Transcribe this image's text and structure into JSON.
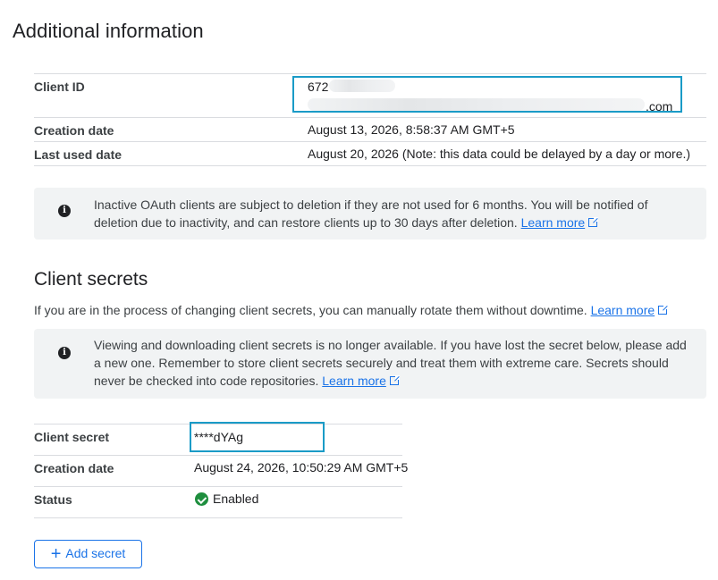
{
  "additional_info": {
    "title": "Additional information",
    "client_id_label": "Client ID",
    "client_id_prefix": "672",
    "client_id_suffix": ".com",
    "creation_date_label": "Creation date",
    "creation_date": "August 13, 2026, 8:58:37 AM GMT+5",
    "last_used_label": "Last used date",
    "last_used": "August 20, 2026 (Note: this data could be delayed by a day or more.)",
    "banner_text": "Inactive OAuth clients are subject to deletion if they are not used for 6 months. You will be notified of deletion due to inactivity, and can restore clients up to 30 days after deletion.",
    "banner_link": "Learn more"
  },
  "client_secrets": {
    "title": "Client secrets",
    "description": "If you are in the process of changing client secrets, you can manually rotate them without downtime.",
    "description_link": "Learn more",
    "banner_text": "Viewing and downloading client secrets is no longer available. If you have lost the secret below, please add a new one. Remember to store client secrets securely and treat them with extreme care. Secrets should never be checked into code repositories.",
    "banner_link": "Learn more",
    "secret_label": "Client secret",
    "secret_value": "****dYAg",
    "creation_date_label": "Creation date",
    "creation_date": "August 24, 2026, 10:50:29 AM GMT+5",
    "status_label": "Status",
    "status_value": "Enabled",
    "add_button_label": "Add secret"
  },
  "icons": [
    "info-icon",
    "external-link-icon",
    "check-circle-icon",
    "plus-icon"
  ],
  "colors": {
    "link": "#1a73e8",
    "enabled": "#1e8e3e",
    "highlight_border": "#1a9bc7",
    "banner_bg": "#f1f3f4"
  }
}
